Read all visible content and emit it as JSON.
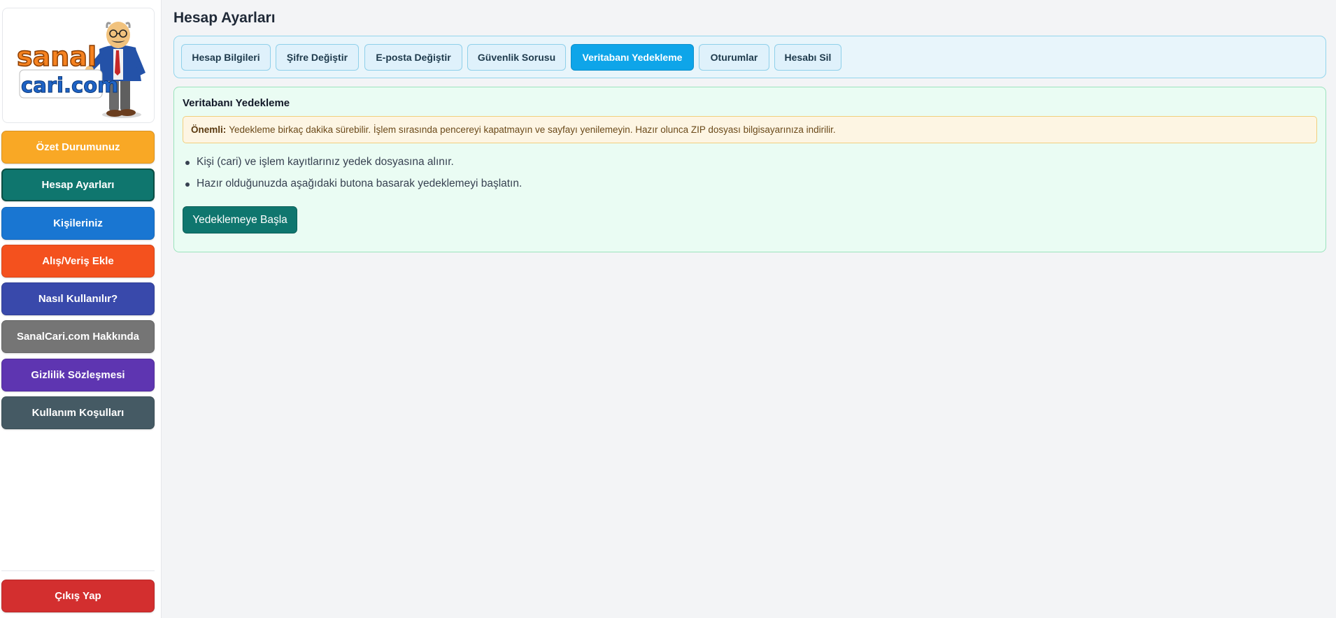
{
  "sidebar": {
    "logo": {
      "line1": "sanal",
      "line2": "cari.com"
    },
    "items": [
      {
        "label": "Özet Durumunuz",
        "color": "#f9a825"
      },
      {
        "label": "Hesap Ayarları",
        "color": "#0f766e"
      },
      {
        "label": "Kişileriniz",
        "color": "#1976d2"
      },
      {
        "label": "Alış/Veriş Ekle",
        "color": "#f4511e"
      },
      {
        "label": "Nasıl Kullanılır?",
        "color": "#3949ab"
      },
      {
        "label": "SanalCari.com Hakkında",
        "color": "#757575"
      },
      {
        "label": "Gizlilik Sözleşmesi",
        "color": "#5e35b1"
      },
      {
        "label": "Kullanım Koşulları",
        "color": "#455a64"
      }
    ],
    "logout": {
      "label": "Çıkış Yap",
      "color": "#d32f2f"
    }
  },
  "main": {
    "title": "Hesap Ayarları",
    "tabs": [
      {
        "label": "Hesap Bilgileri"
      },
      {
        "label": "Şifre Değiştir"
      },
      {
        "label": "E-posta Değiştir"
      },
      {
        "label": "Güvenlik Sorusu"
      },
      {
        "label": "Veritabanı Yedekleme",
        "active": true
      },
      {
        "label": "Oturumlar"
      },
      {
        "label": "Hesabı Sil"
      }
    ],
    "panel": {
      "title": "Veritabanı Yedekleme",
      "notice_label": "Önemli:",
      "notice_text": "Yedekleme birkaç dakika sürebilir. İşlem sırasında pencereyi kapatmayın ve sayfayı yenilemeyin. Hazır olunca ZIP dosyası bilgisayarınıza indirilir.",
      "bullets": [
        "Kişi (cari) ve işlem kayıtlarınız yedek dosyasına alınır.",
        "Hazır olduğunuzda aşağıdaki butona basarak yedeklemeyi başlatın."
      ],
      "start_button": "Yedeklemeye Başla"
    }
  }
}
